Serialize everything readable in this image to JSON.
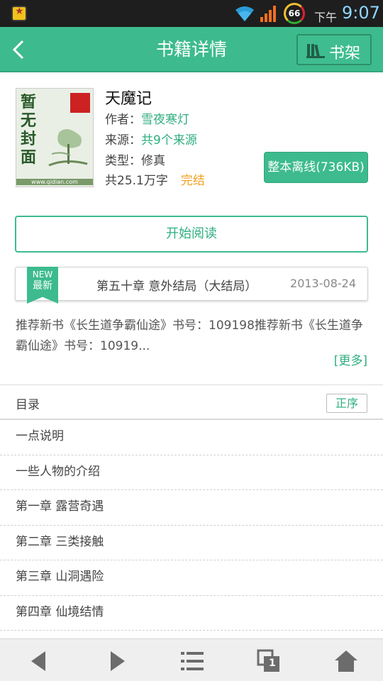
{
  "status_bar": {
    "battery_level": "66",
    "ampm": "下午",
    "time": "9:07"
  },
  "header": {
    "title": "书籍详情",
    "shelf_label": "书架"
  },
  "book": {
    "title": "天魔记",
    "author_label": "作者：",
    "author": "雪夜寒灯",
    "source_label": "来源：",
    "source": "共9个来源",
    "type_label": "类型：",
    "type": "修真",
    "word_count": "共25.1万字",
    "status": "完结",
    "cover_text": "暂无封面",
    "cover_url": "www.qidian.com"
  },
  "offline_button": "整本离线(736KB)",
  "start_button": "开始阅读",
  "latest": {
    "badge_top": "NEW",
    "badge_bottom": "最新",
    "chapter": "第五十章 意外结局（大结局）",
    "date": "2013-08-24"
  },
  "description": "推荐新书《长生道争霸仙途》书号：109198推荐新书《长生道争霸仙途》书号：10919...",
  "more_link": "[更多]",
  "toc": {
    "title": "目录",
    "order_button": "正序",
    "chapters": [
      "一点说明",
      "一些人物的介绍",
      "第一章 露营奇遇",
      "第二章 三类接触",
      "第三章 山洞遇险",
      "第四章 仙境结情"
    ]
  },
  "bottom_bar": {
    "buttons": [
      "back-arrow-icon",
      "forward-arrow-icon",
      "menu-list-icon",
      "tabs-icon",
      "home-icon"
    ],
    "tab_count": "1"
  },
  "colors": {
    "accent": "#3dbb8e",
    "status_done": "#f0a020"
  }
}
